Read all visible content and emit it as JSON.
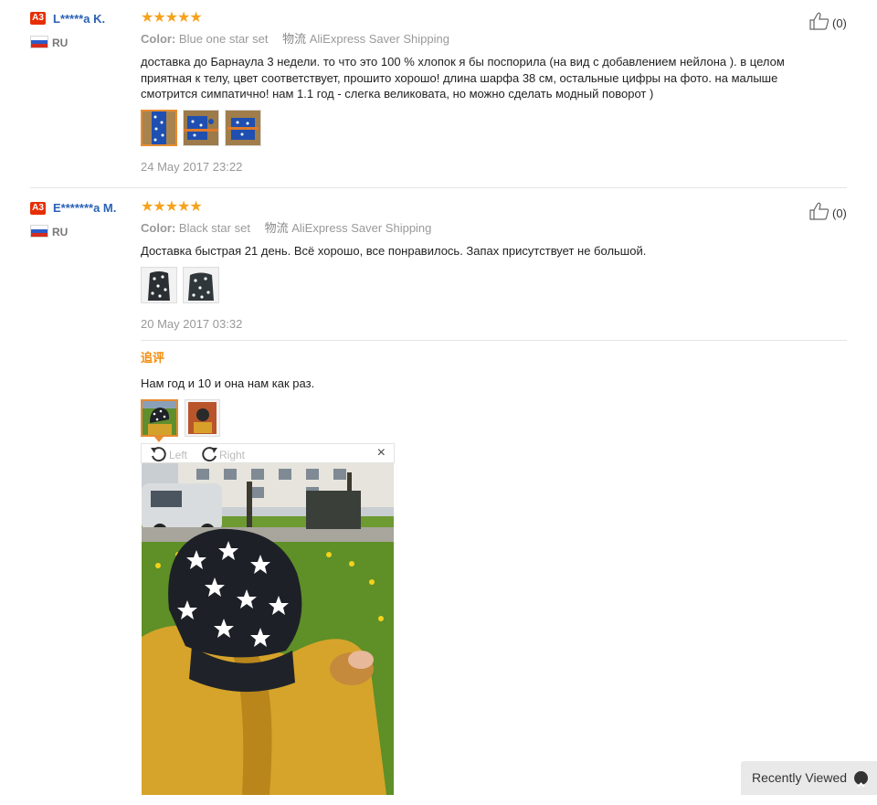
{
  "colors": {
    "accent": "#e88b2e",
    "link": "#2a62b5",
    "star": "#f6a21d",
    "badge": "#e62e04"
  },
  "reviews": [
    {
      "badge": "A3",
      "username": "L*****a K.",
      "country": "RU",
      "rating": 5,
      "stars": "★★★★★",
      "color_label": "Color:",
      "color_value": "Blue one star set",
      "ship_icon": "物流",
      "shipping": "AliExpress Saver Shipping",
      "text": "доставка до Барнаула 3 недели. то что это 100 % хлопок я бы поспорила (на вид с добавлением нейлона ). в целом приятная к телу, цвет соответствует, прошито хорошо! длина шарфа 38 см, остальные цифры на фото. на малыше смотрится симпатично! нам 1.1 год - слегка великовата, но можно сделать модный поворот )",
      "date": "24 May 2017 23:22",
      "likes": "(0)"
    },
    {
      "badge": "A3",
      "username": "E*******a M.",
      "country": "RU",
      "rating": 5,
      "stars": "★★★★★",
      "color_label": "Color:",
      "color_value": "Black star set",
      "ship_icon": "物流",
      "shipping": "AliExpress Saver Shipping",
      "text": "Доставка быстрая 21 день. Всё хорошо, все понравилось. Запах присутствует не большой.",
      "date": "20 May 2017 03:32",
      "likes": "(0)",
      "additional": {
        "title": "追评",
        "text": "Нам год и 10 и она нам как раз."
      }
    }
  ],
  "viewer": {
    "rotate_left": "Left",
    "rotate_right": "Right",
    "close": "×"
  },
  "recently_viewed": {
    "label": "Recently Viewed",
    "icon": "chevron-up-icon"
  }
}
